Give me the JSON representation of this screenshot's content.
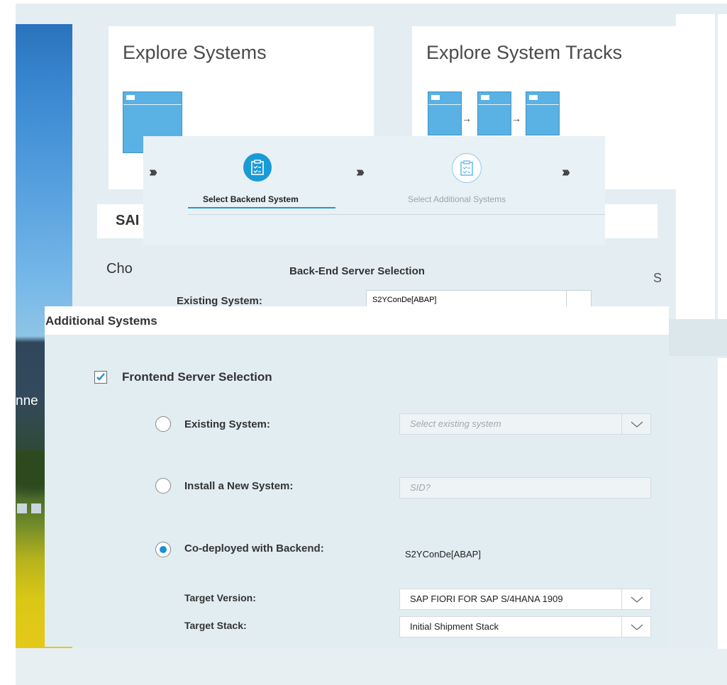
{
  "tiles": {
    "explore_systems": "Explore Systems",
    "explore_tracks": "Explore System Tracks"
  },
  "background": {
    "partial_text": "nne"
  },
  "wizard": {
    "step1_label": "Select Backend System",
    "step2_label": "Select Additional Systems",
    "step1_icon": "clipboard-checklist-icon",
    "step2_icon": "clipboard-checklist-icon"
  },
  "underlying_dialog": {
    "title_fragment": "SAI",
    "heading_fragment": "Cho",
    "section_label": "Back-End Server Selection",
    "existing_label": "Existing System:",
    "existing_value": "S2YConDe[ABAP]",
    "right_fragment": "S"
  },
  "panel": {
    "title": "Additional Systems",
    "frontend_checkbox": {
      "label": "Frontend Server Selection",
      "checked": true
    },
    "options": {
      "existing": {
        "label": "Existing System:",
        "placeholder": "Select existing system",
        "selected": false
      },
      "install": {
        "label": "Install a New System:",
        "placeholder": "SID?",
        "selected": false
      },
      "codeployed": {
        "label": "Co-deployed with Backend:",
        "value": "S2YConDe[ABAP]",
        "selected": true
      }
    },
    "target_version": {
      "label": "Target Version:",
      "value": "SAP FIORI FOR SAP S/4HANA 1909"
    },
    "target_stack": {
      "label": "Target Stack:",
      "value": "Initial Shipment Stack"
    }
  },
  "colors": {
    "accent": "#1a9ad6",
    "panel_bg": "#e2edf1",
    "tile_icon": "#5ab1e4"
  }
}
